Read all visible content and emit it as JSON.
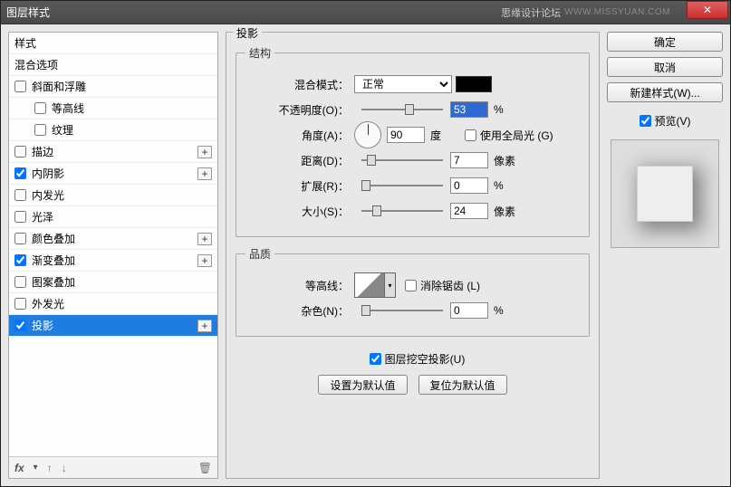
{
  "window": {
    "title": "图层样式",
    "forum": "思缘设计论坛",
    "url": "WWW.MISSYUAN.COM"
  },
  "left": {
    "header_styles": "样式",
    "header_blend": "混合选项",
    "items": [
      {
        "label": "斜面和浮雕",
        "checked": false,
        "plus": false,
        "indent": false
      },
      {
        "label": "等高线",
        "checked": false,
        "plus": false,
        "indent": true
      },
      {
        "label": "纹理",
        "checked": false,
        "plus": false,
        "indent": true
      },
      {
        "label": "描边",
        "checked": false,
        "plus": true,
        "indent": false
      },
      {
        "label": "内阴影",
        "checked": true,
        "plus": true,
        "indent": false
      },
      {
        "label": "内发光",
        "checked": false,
        "plus": false,
        "indent": false
      },
      {
        "label": "光泽",
        "checked": false,
        "plus": false,
        "indent": false
      },
      {
        "label": "颜色叠加",
        "checked": false,
        "plus": true,
        "indent": false
      },
      {
        "label": "渐变叠加",
        "checked": true,
        "plus": true,
        "indent": false
      },
      {
        "label": "图案叠加",
        "checked": false,
        "plus": false,
        "indent": false
      },
      {
        "label": "外发光",
        "checked": false,
        "plus": false,
        "indent": false
      },
      {
        "label": "投影",
        "checked": true,
        "plus": true,
        "indent": false,
        "selected": true
      }
    ],
    "footer_fx": "fx"
  },
  "center": {
    "section_title": "投影",
    "structure": {
      "legend": "结构",
      "blend_mode_label": "混合模式：",
      "blend_mode_value": "正常",
      "opacity_label": "不透明度(O)：",
      "opacity_value": "53",
      "opacity_unit": "%",
      "angle_label": "角度(A)：",
      "angle_value": "90",
      "angle_unit": "度",
      "global_light_label": "使用全局光 (G)",
      "global_light_checked": false,
      "distance_label": "距离(D)：",
      "distance_value": "7",
      "distance_unit": "像素",
      "spread_label": "扩展(R)：",
      "spread_value": "0",
      "spread_unit": "%",
      "size_label": "大小(S)：",
      "size_value": "24",
      "size_unit": "像素"
    },
    "quality": {
      "legend": "品质",
      "contour_label": "等高线：",
      "antialias_label": "消除锯齿 (L)",
      "antialias_checked": false,
      "noise_label": "杂色(N)：",
      "noise_value": "0",
      "noise_unit": "%"
    },
    "knockout_label": "图层挖空投影(U)",
    "knockout_checked": true,
    "btn_default": "设置为默认值",
    "btn_reset": "复位为默认值"
  },
  "right": {
    "ok": "确定",
    "cancel": "取消",
    "new_style": "新建样式(W)...",
    "preview_label": "预览(V)",
    "preview_checked": true
  }
}
